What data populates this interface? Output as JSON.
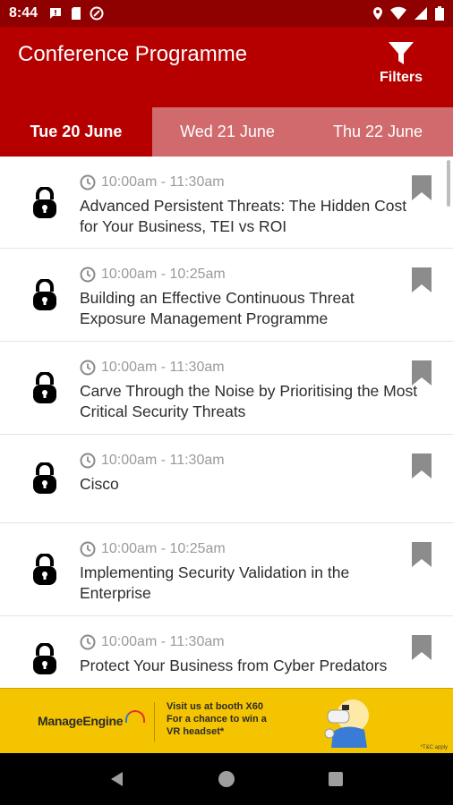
{
  "status": {
    "time": "8:44"
  },
  "app": {
    "title": "Conference Programme",
    "filters_label": "Filters"
  },
  "tabs": [
    {
      "label": "Tue 20 June",
      "selected": true
    },
    {
      "label": "Wed 21 June",
      "selected": false
    },
    {
      "label": "Thu 22 June",
      "selected": false
    }
  ],
  "sessions": [
    {
      "time": "10:00am - 11:30am",
      "title": "Advanced Persistent Threats: The Hidden Cost for Your Business, TEI vs ROI",
      "icon": "padlock-icon"
    },
    {
      "time": "10:00am - 10:25am",
      "title": "Building an Effective Continuous Threat Exposure Management Programme",
      "icon": "padlock-icon"
    },
    {
      "time": "10:00am - 11:30am",
      "title": "Carve Through the Noise by Prioritising the Most Critical Security Threats",
      "icon": "padlock-icon"
    },
    {
      "time": "10:00am - 11:30am",
      "title": "Cisco",
      "icon": "padlock-icon"
    },
    {
      "time": "10:00am - 10:25am",
      "title": "Implementing Security Validation in the Enterprise",
      "icon": "padlock-icon"
    },
    {
      "time": "10:00am - 11:30am",
      "title": "Protect Your Business from Cyber Predators",
      "icon": "padlock-icon"
    }
  ],
  "banner": {
    "brand": "ManageEngine",
    "line1": "Visit us at booth X60",
    "line2": "For a chance to win a",
    "line3": "VR headset*",
    "terms": "*T&C apply"
  },
  "colors": {
    "status_bar": "#8f0000",
    "primary": "#b60000",
    "tab_inactive": "#d06a6d",
    "banner": "#f5c400"
  }
}
